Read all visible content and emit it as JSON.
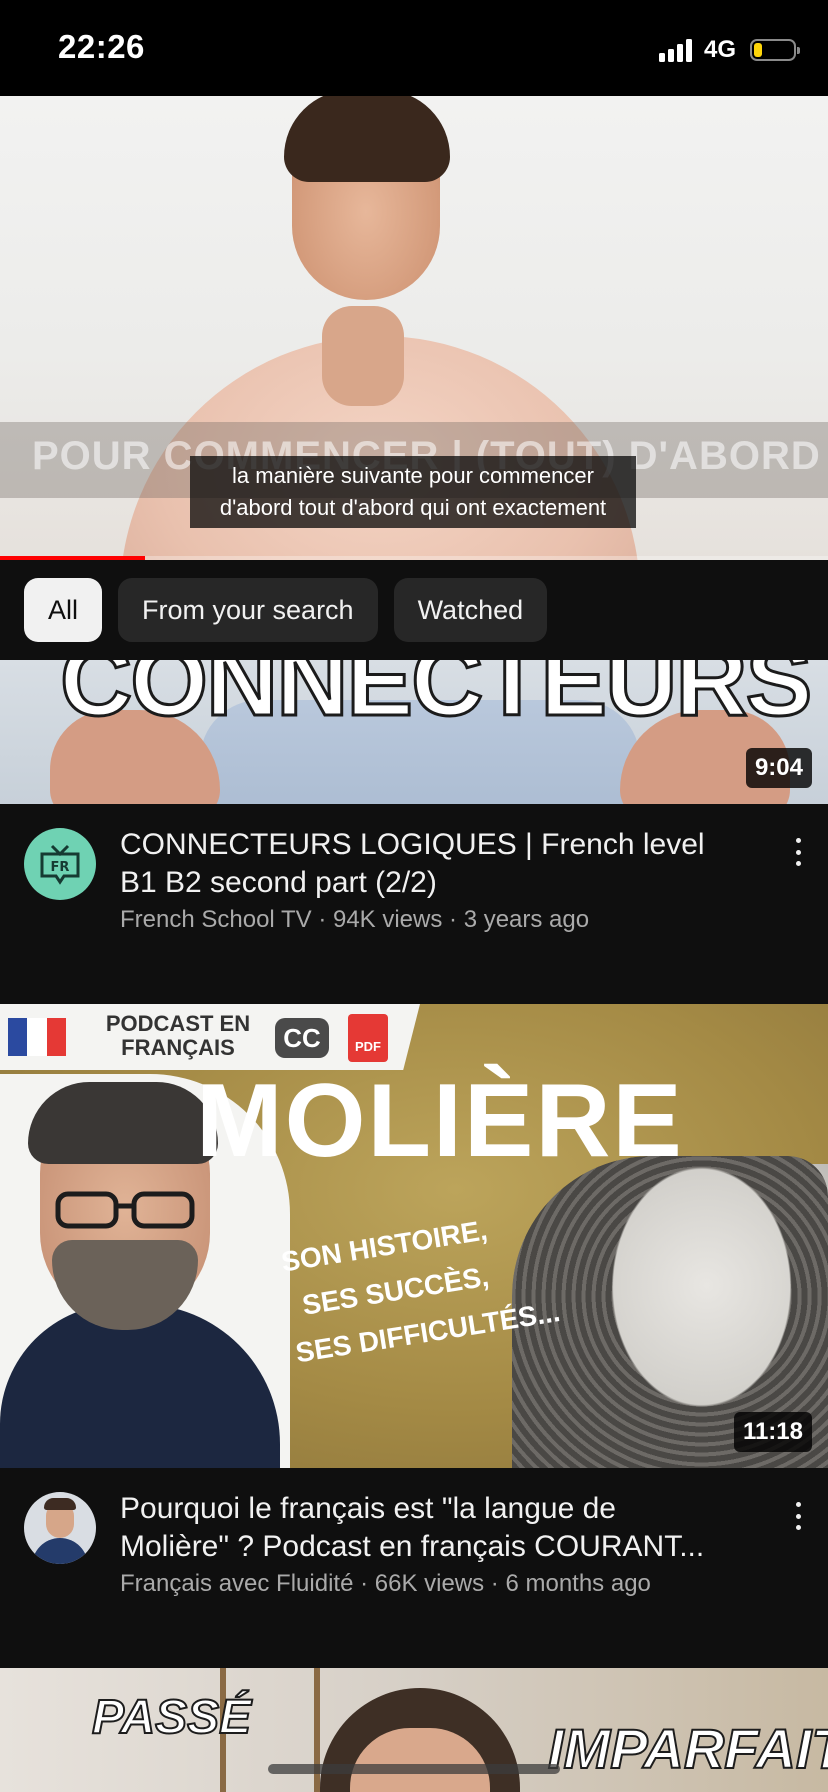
{
  "status_bar": {
    "time": "22:26",
    "network": "4G",
    "battery_level": 0.2,
    "battery_color": "#ffd60a"
  },
  "player": {
    "banner_text": "POUR COMMENCER | (TOUT) D'ABORD",
    "caption_lines": [
      "la manière suivante pour commencer",
      "d'abord tout d'abord qui ont exactement"
    ],
    "progress": 0.175,
    "progress_color": "#ff0000"
  },
  "chips": [
    {
      "label": "All",
      "active": true
    },
    {
      "label": "From your search",
      "active": false
    },
    {
      "label": "Watched",
      "active": false
    }
  ],
  "videos": [
    {
      "thumbnail_text": "CONNECTEURS",
      "duration": "9:04",
      "title_lines": [
        "CONNECTEURS LOGIQUES | French level",
        "B1 B2 second part (2/2)"
      ],
      "subtitle": "French School TV · 94K views · 3 years ago",
      "avatar_icon": "fr-tv-logo-icon",
      "avatar_color": "#6fd2b3"
    },
    {
      "thumbnail_banner": "PODCAST EN FRANÇAIS",
      "thumbnail_cc": "CC",
      "thumbnail_pdf": "PDF",
      "thumbnail_title": "MOLIÈRE",
      "thumbnail_tagline": [
        "SON HISTOIRE,",
        "SES SUCCÈS,",
        "SES DIFFICULTÉS..."
      ],
      "duration": "11:18",
      "title_lines": [
        "Pourquoi le français est \"la langue de",
        "Molière\" ? Podcast en français COURANT..."
      ],
      "subtitle": "Français avec Fluidité · 66K views · 6 months ago",
      "avatar_icon": "channel-avatar-person"
    },
    {
      "thumbnail_left_text": "PASSÉ",
      "thumbnail_right_text": "IMPARFAIT"
    }
  ],
  "flag_colors": [
    "#2b4aa0",
    "#ffffff",
    "#e53935"
  ]
}
